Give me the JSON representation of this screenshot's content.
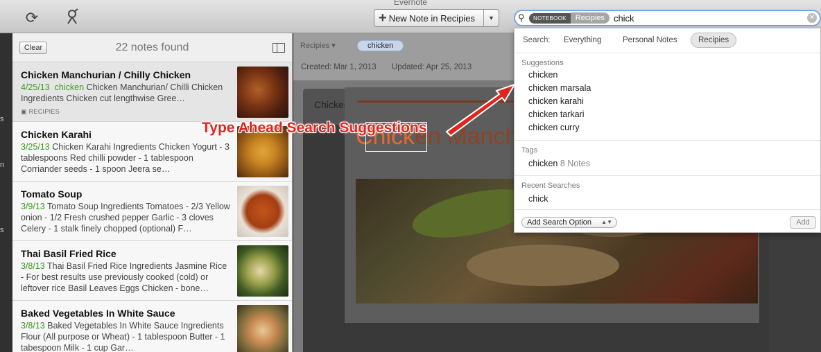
{
  "window": {
    "title": "Evernote"
  },
  "toolbar": {
    "sync_icon": "sync-icon",
    "connect_icon": "satellite-icon",
    "new_note_label": "New Note in Recipies"
  },
  "search": {
    "notebook_chip": "NOTEBOOK",
    "scope_chip": "Recipies",
    "query": "chick"
  },
  "notelist": {
    "clear_label": "Clear",
    "count_text": "22 notes found",
    "notes": [
      {
        "title": "Chicken Manchurian / Chilly Chicken",
        "date": "4/25/13",
        "highlight": "chicken",
        "snippet": " Chicken Manchurian/ Chilli Chicken Ingredients Chicken cut lengthwise Gree…",
        "tag": "RECIPIES"
      },
      {
        "title": "Chicken Karahi",
        "date": "3/25/13",
        "snippet": " Chicken Karahi Ingredients Chicken Yogurt - 3 tablespoons Red chilli powder - 1 tablespoon Corriander seeds - 1 spoon Jeera se…"
      },
      {
        "title": "Tomato Soup",
        "date": "3/9/13",
        "snippet": " Tomato Soup Ingredients Tomatoes - 2/3 Yellow onion - 1/2 Fresh crushed pepper Garlic - 3 cloves Celery - 1 stalk finely chopped (optional) F…"
      },
      {
        "title": "Thai Basil Fried Rice",
        "date": "3/8/13",
        "snippet": " Thai Basil Fried Rice Ingredients Jasmine Rice - For best results use previously cooked (cold) or leftover rice Basil Leaves Eggs Chicken - bone…"
      },
      {
        "title": "Baked Vegetables In White Sauce",
        "date": "3/8/13",
        "snippet": " Baked Vegetables In White Sauce Ingredients Flour (All purpose or Wheat) - 1 tablespoon Butter - 1 tabespoon Milk - 1 cup Gar…"
      }
    ]
  },
  "editor": {
    "notebook": "Recipies",
    "tag": "chicken",
    "created": "Created: Mar 1, 2013",
    "updated": "Updated: Apr 25, 2013",
    "card_title": "Chicken Manchurian / Chilly Chicken",
    "heading_selected": "Chick",
    "heading_rest": "en Manch"
  },
  "popup": {
    "search_label": "Search:",
    "scopes": [
      "Everything",
      "Personal Notes",
      "Recipies"
    ],
    "suggestions_header": "Suggestions",
    "suggestions": [
      "chicken",
      "chicken marsala",
      "chicken karahi",
      "chicken tarkari",
      "chicken curry"
    ],
    "tags_header": "Tags",
    "tag_item": "chicken",
    "tag_count": "8 Notes",
    "recent_header": "Recent Searches",
    "recent_item": "chick",
    "add_option_label": "Add Search Option",
    "add_label": "Add"
  },
  "annotation": {
    "text": "Type Ahead Search Suggestions",
    "color": "#e0261c"
  }
}
